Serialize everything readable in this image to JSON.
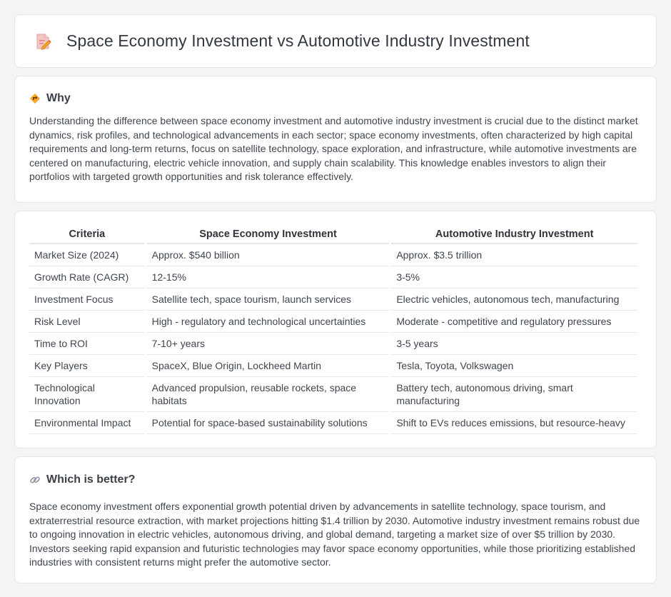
{
  "header": {
    "title": "Space Economy Investment vs Automotive Industry Investment",
    "icon": "document-edit-icon"
  },
  "why": {
    "title": "Why",
    "icon": "warning-sign-icon",
    "text": "Understanding the difference between space economy investment and automotive industry investment is crucial due to the distinct market dynamics, risk profiles, and technological advancements in each sector; space economy investments, often characterized by high capital requirements and long-term returns, focus on satellite technology, space exploration, and infrastructure, while automotive investments are centered on manufacturing, electric vehicle innovation, and supply chain scalability. This knowledge enables investors to align their portfolios with targeted growth opportunities and risk tolerance effectively."
  },
  "table": {
    "headers": [
      "Criteria",
      "Space Economy Investment",
      "Automotive Industry Investment"
    ],
    "rows": [
      [
        "Market Size (2024)",
        "Approx. $540 billion",
        "Approx. $3.5 trillion"
      ],
      [
        "Growth Rate (CAGR)",
        "12-15%",
        "3-5%"
      ],
      [
        "Investment Focus",
        "Satellite tech, space tourism, launch services",
        "Electric vehicles, autonomous tech, manufacturing"
      ],
      [
        "Risk Level",
        "High - regulatory and technological uncertainties",
        "Moderate - competitive and regulatory pressures"
      ],
      [
        "Time to ROI",
        "7-10+ years",
        "3-5 years"
      ],
      [
        "Key Players",
        "SpaceX, Blue Origin, Lockheed Martin",
        "Tesla, Toyota, Volkswagen"
      ],
      [
        "Technological Innovation",
        "Advanced propulsion, reusable rockets, space habitats",
        "Battery tech, autonomous driving, smart manufacturing"
      ],
      [
        "Environmental Impact",
        "Potential for space-based sustainability solutions",
        "Shift to EVs reduces emissions, but resource-heavy"
      ]
    ]
  },
  "better": {
    "title": "Which is better?",
    "icon": "link-icon",
    "text": "Space economy investment offers exponential growth potential driven by advancements in satellite technology, space tourism, and extraterrestrial resource extraction, with market projections hitting $1.4 trillion by 2030. Automotive industry investment remains robust due to ongoing innovation in electric vehicles, autonomous driving, and global demand, targeting a market size of over $5 trillion by 2030. Investors seeking rapid expansion and futuristic technologies may favor space economy opportunities, while those prioritizing established industries with consistent returns might prefer the automotive sector."
  }
}
